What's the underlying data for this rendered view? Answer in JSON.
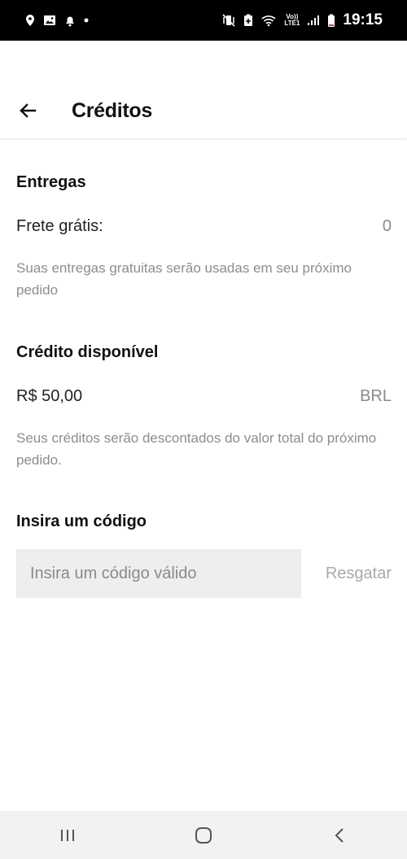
{
  "status_bar": {
    "time": "19:15",
    "network_label_top": "Vo))",
    "network_label_bottom": "LTE1",
    "icons": [
      "location-icon",
      "gallery-icon",
      "notification-icon",
      "dot-icon",
      "mute-vibrate-icon",
      "battery-saver-icon",
      "wifi-icon",
      "signal-icon",
      "battery-icon"
    ]
  },
  "header": {
    "title": "Créditos",
    "back_icon": "arrow-left-icon"
  },
  "deliveries": {
    "section_title": "Entregas",
    "label": "Frete grátis:",
    "value": "0",
    "note": "Suas entregas gratuitas serão usadas em seu próximo pedido"
  },
  "credit": {
    "section_title": "Crédito disponível",
    "amount": "R$ 50,00",
    "currency": "BRL",
    "note": "Seus créditos serão descontados do valor total do próximo pedido."
  },
  "promo": {
    "section_title": "Insira um código",
    "input_value": "",
    "input_placeholder": "Insira um código válido",
    "redeem_label": "Resgatar"
  },
  "nav_bar": {
    "icons": [
      "recent-apps-icon",
      "home-icon",
      "back-icon"
    ]
  },
  "colors": {
    "status_bar_bg": "#000000",
    "input_bg": "#eeeeee",
    "muted_text": "#8d8d8d",
    "nav_bar_bg": "#f2f2f2"
  }
}
